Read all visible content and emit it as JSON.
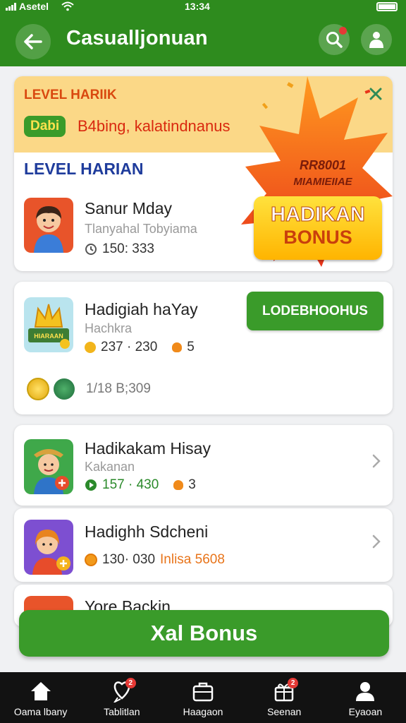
{
  "status_bar": {
    "carrier": "Asetel",
    "time": "13:34"
  },
  "app_bar": {
    "title": "Casualljonuan"
  },
  "promo": {
    "band_title": "LEVEL HARIIK",
    "tag": "Dabi",
    "band_subtitle": "B4bing, kalatindnanus",
    "section_title": "LEVEL HARIAN",
    "prize_line1": "RR8001",
    "prize_line2": "MIAMIEIIAE",
    "bonus_line1": "HADIKAN",
    "bonus_line2": "BONUS",
    "row": {
      "title": "Sanur Mday",
      "subtitle": "Tlanyahal Tobyiama",
      "meta": "150: 333"
    }
  },
  "item1": {
    "title": "Hadigiah haYay",
    "subtitle": "Hachkra",
    "meta_a": "237 · 230",
    "meta_b": "5",
    "button_label": "LODEBHOOHUS",
    "footer_meta": "1/18 B;309",
    "badge_text": "HIARAAN"
  },
  "item2": {
    "title": "Hadikakam Hisay",
    "subtitle": "Kakanan",
    "meta_a": "157 · 430",
    "meta_b": "3"
  },
  "item3": {
    "title": "Hadighh Sdcheni",
    "meta_a": "130· 030",
    "meta_b": "Inlisa 5608"
  },
  "item4": {
    "title": "Yore Backin"
  },
  "cta": {
    "label": "Xal Bonus"
  },
  "tabs": [
    {
      "label": "Oama lbany",
      "icon": "home-icon",
      "badge": ""
    },
    {
      "label": "Tablitlan",
      "icon": "heart-chat-icon",
      "badge": "2"
    },
    {
      "label": "Haagaon",
      "icon": "briefcase-icon",
      "badge": ""
    },
    {
      "label": "Seenan",
      "icon": "gift-icon",
      "badge": "2"
    },
    {
      "label": "Eyaoan",
      "icon": "profile-icon",
      "badge": ""
    }
  ],
  "colors": {
    "primary_green": "#2e8b1e",
    "accent_orange": "#d9480f",
    "promo_band": "#fbd887",
    "heading_blue": "#1f3c9c"
  }
}
